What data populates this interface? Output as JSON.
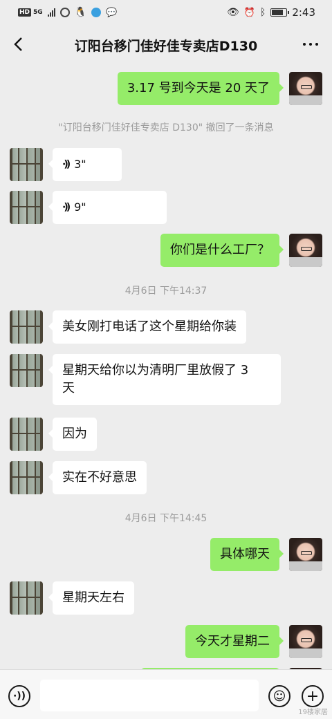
{
  "status_bar": {
    "network_badge": "HD",
    "network_type": "5G",
    "time": "2:43",
    "battery_level": 0.8
  },
  "header": {
    "title": "订阳台移门佳好佳专卖店D130"
  },
  "messages": [
    {
      "side": "right",
      "text": "3.17 号到今天是 20 天了"
    },
    {
      "system": "\"订阳台移门佳好佳专卖店 D130\" 撤回了一条消息"
    },
    {
      "side": "left",
      "voice": "3\""
    },
    {
      "side": "left",
      "voice": "9\""
    },
    {
      "side": "right",
      "text": "你们是什么工厂？"
    },
    {
      "system": "4月6日 下午14:37"
    },
    {
      "side": "left",
      "text": "美女刚打电话了这个星期给你装"
    },
    {
      "side": "left",
      "text_line1": "星期天给你以为清明厂里放假了 3",
      "text_line2": "天"
    },
    {
      "side": "left",
      "text": "因为"
    },
    {
      "side": "left",
      "text": "实在不好意思"
    },
    {
      "system": "4月6日 下午14:45"
    },
    {
      "side": "right",
      "text": "具体哪天"
    },
    {
      "side": "left",
      "text": "星期天左右"
    },
    {
      "side": "right",
      "text": "今天才星期二"
    }
  ],
  "watermark": "19楼家居",
  "colors": {
    "background": "#ededed",
    "sent_bubble": "#95ec69",
    "received_bubble": "#ffffff"
  }
}
